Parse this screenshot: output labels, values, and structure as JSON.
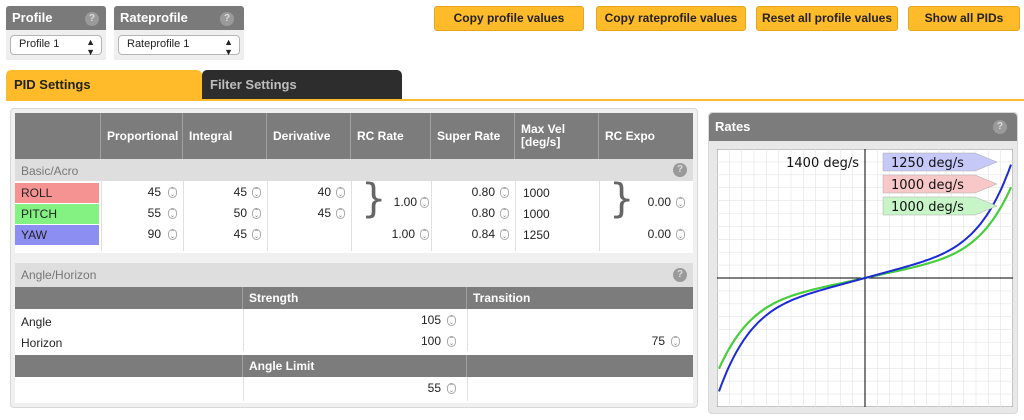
{
  "profile": {
    "title": "Profile",
    "selected": "Profile 1"
  },
  "rateprofile": {
    "title": "Rateprofile",
    "selected": "Rateprofile 1"
  },
  "help_glyph": "?",
  "buttons": {
    "copy_profile": "Copy profile values",
    "copy_rateprofile": "Copy rateprofile values",
    "reset_profile": "Reset all profile values",
    "show_pids": "Show all PIDs"
  },
  "tabs": {
    "pid": "PID Settings",
    "filter": "Filter Settings"
  },
  "pid_table": {
    "headers": [
      "Proportional",
      "Integral",
      "Derivative",
      "RC Rate",
      "Super Rate",
      "Max Vel [deg/s]",
      "RC Expo"
    ],
    "section": "Basic/Acro",
    "rows": [
      {
        "axis": "ROLL",
        "color": "#f59393",
        "p": "45",
        "i": "45",
        "d": "40",
        "super_rate": "0.80",
        "max_vel": "1000"
      },
      {
        "axis": "PITCH",
        "color": "#83f283",
        "p": "55",
        "i": "50",
        "d": "45",
        "super_rate": "0.80",
        "max_vel": "1000"
      },
      {
        "axis": "YAW",
        "color": "#8d8ef2",
        "p": "90",
        "i": "45",
        "d": "",
        "rc_rate": "1.00",
        "super_rate": "0.84",
        "max_vel": "1250",
        "rc_expo": "0.00"
      }
    ],
    "rollpitch_rc_rate": "1.00",
    "rollpitch_rc_expo": "0.00"
  },
  "angle_horizon": {
    "section": "Angle/Horizon",
    "strength_header": "Strength",
    "transition_header": "Transition",
    "angle_label": "Angle",
    "angle_strength": "105",
    "horizon_label": "Horizon",
    "horizon_strength": "100",
    "horizon_transition": "75",
    "angle_limit_header": "Angle Limit",
    "angle_limit": "55"
  },
  "rates": {
    "title": "Rates",
    "max_label": "1400 deg/s",
    "legend": [
      {
        "text": "1250 deg/s",
        "color": "#c6c8f8",
        "line": "#1c2ad8"
      },
      {
        "text": "1000 deg/s",
        "color": "#f8c8c8",
        "line": "#d85050"
      },
      {
        "text": "1000 deg/s",
        "color": "#c8f5c8",
        "line": "#3ad63a"
      }
    ]
  },
  "chart_data": {
    "type": "line",
    "title": "Rates",
    "xlabel": "",
    "ylabel": "",
    "ylim": [
      -1400,
      1400
    ],
    "series": [
      {
        "name": "YAW",
        "max_rate": 1250
      },
      {
        "name": "ROLL",
        "max_rate": 1000
      },
      {
        "name": "PITCH",
        "max_rate": 1000
      }
    ]
  }
}
